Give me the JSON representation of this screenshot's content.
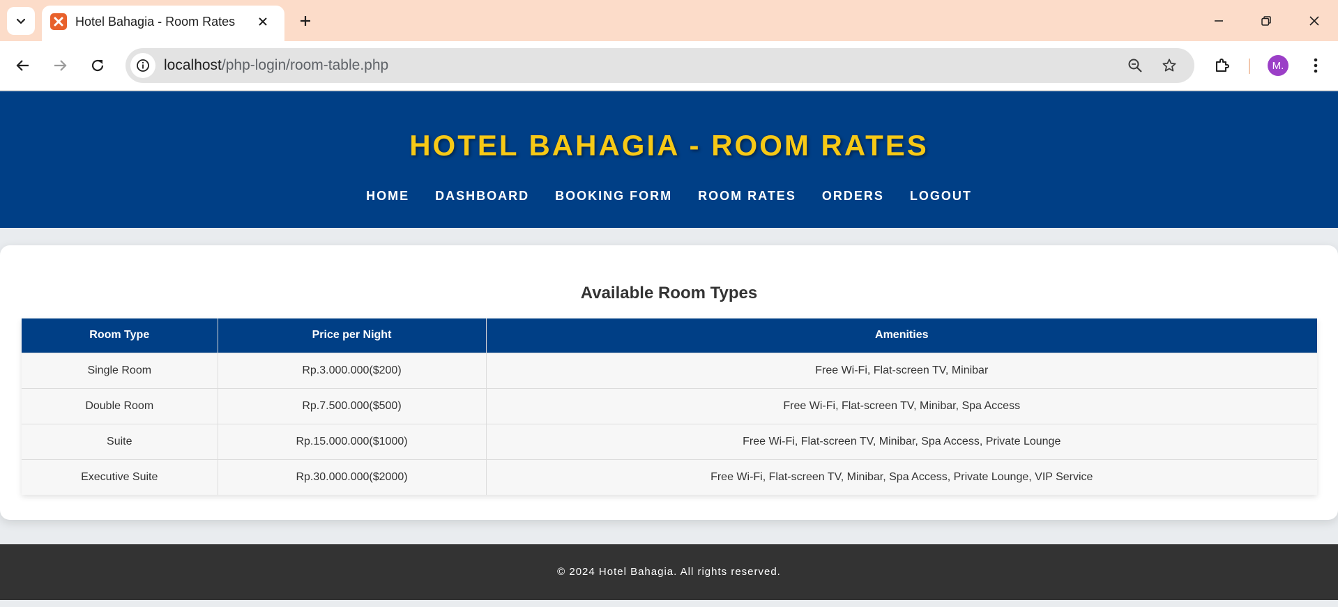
{
  "browser": {
    "tab_title": "Hotel Bahagia - Room Rates",
    "url_host": "localhost",
    "url_path": "/php-login/room-table.php",
    "profile_initial": "M.",
    "colors": {
      "tabstrip": "#fcdcc9",
      "avatar": "#9b3fc7",
      "favicon": "#e8612c"
    }
  },
  "header": {
    "title": "HOTEL BAHAGIA - ROOM RATES",
    "nav": [
      {
        "label": "HOME"
      },
      {
        "label": "DASHBOARD"
      },
      {
        "label": "BOOKING FORM"
      },
      {
        "label": "ROOM RATES"
      },
      {
        "label": "ORDERS"
      },
      {
        "label": "LOGOUT"
      }
    ],
    "colors": {
      "background": "#003f86",
      "title": "#f7c916"
    }
  },
  "main": {
    "title": "Available Room Types",
    "table": {
      "headers": [
        "Room Type",
        "Price per Night",
        "Amenities"
      ],
      "rows": [
        [
          "Single Room",
          "Rp.3.000.000($200)",
          "Free Wi-Fi, Flat-screen TV, Minibar"
        ],
        [
          "Double Room",
          "Rp.7.500.000($500)",
          "Free Wi-Fi, Flat-screen TV, Minibar, Spa Access"
        ],
        [
          "Suite",
          "Rp.15.000.000($1000)",
          "Free Wi-Fi, Flat-screen TV, Minibar, Spa Access, Private Lounge"
        ],
        [
          "Executive Suite",
          "Rp.30.000.000($2000)",
          "Free Wi-Fi, Flat-screen TV, Minibar, Spa Access, Private Lounge, VIP Service"
        ]
      ]
    }
  },
  "footer": {
    "text": "© 2024 Hotel Bahagia. All rights reserved.",
    "background": "#333333"
  }
}
